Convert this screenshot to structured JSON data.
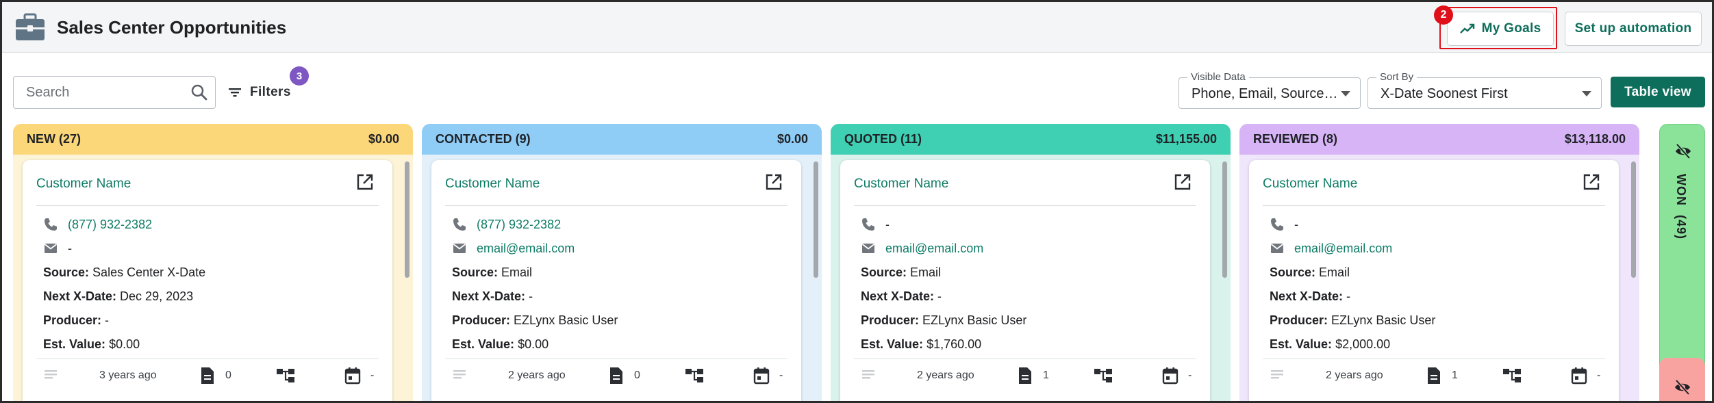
{
  "header": {
    "title": "Sales Center Opportunities",
    "my_goals_label": "My Goals",
    "highlight_badge": "2",
    "automation_label": "Set up automation"
  },
  "toolbar": {
    "search_placeholder": "Search",
    "filters_label": "Filters",
    "filters_count": "3",
    "visible_data": {
      "label": "Visible Data",
      "value": "Phone, Email, Source, ..."
    },
    "sort_by": {
      "label": "Sort By",
      "value": "X-Date Soonest First"
    },
    "table_view_label": "Table view"
  },
  "labels": {
    "source": "Source:",
    "next_xdate": "Next X-Date:",
    "producer": "Producer:",
    "est_value": "Est. Value:"
  },
  "columns": [
    {
      "name": "NEW (27)",
      "total": "$0.00",
      "header_color": "#fcd77a",
      "body_color": "#fdf3d7",
      "card": {
        "customer": "Customer Name",
        "phone": "(877) 932-2382",
        "phone_is_link": true,
        "email": "-",
        "email_is_link": false,
        "source": "Sales Center X-Date",
        "next_xdate": "Dec 29, 2023",
        "producer": "-",
        "est_value": "$0.00",
        "time": "3 years ago",
        "doc_count": "0",
        "calendar": "-"
      }
    },
    {
      "name": "CONTACTED (9)",
      "total": "$0.00",
      "header_color": "#8fcdf7",
      "body_color": "#e3f0fa",
      "card": {
        "customer": "Customer Name",
        "phone": "(877) 932-2382",
        "phone_is_link": true,
        "email": "email@email.com",
        "email_is_link": true,
        "source": "Email",
        "next_xdate": "-",
        "producer": "EZLynx Basic User",
        "est_value": "$0.00",
        "time": "2 years ago",
        "doc_count": "0",
        "calendar": "-"
      }
    },
    {
      "name": "QUOTED (11)",
      "total": "$11,155.00",
      "header_color": "#3fcfb3",
      "body_color": "#d9f2ec",
      "card": {
        "customer": "Customer Name",
        "phone": "-",
        "phone_is_link": false,
        "email": "email@email.com",
        "email_is_link": true,
        "source": "Email",
        "next_xdate": "-",
        "producer": "EZLynx Basic User",
        "est_value": "$1,760.00",
        "time": "2 years ago",
        "doc_count": "1",
        "calendar": "-"
      }
    },
    {
      "name": "REVIEWED (8)",
      "total": "$13,118.00",
      "header_color": "#d6b4f6",
      "body_color": "#f0e6fb",
      "card": {
        "customer": "Customer Name",
        "phone": "-",
        "phone_is_link": false,
        "email": "email@email.com",
        "email_is_link": true,
        "source": "Email",
        "next_xdate": "-",
        "producer": "EZLynx Basic User",
        "est_value": "$2,000.00",
        "time": "2 years ago",
        "doc_count": "1",
        "calendar": "-"
      }
    }
  ],
  "collapsed": {
    "won_label": "WON",
    "won_count": "(49)"
  }
}
